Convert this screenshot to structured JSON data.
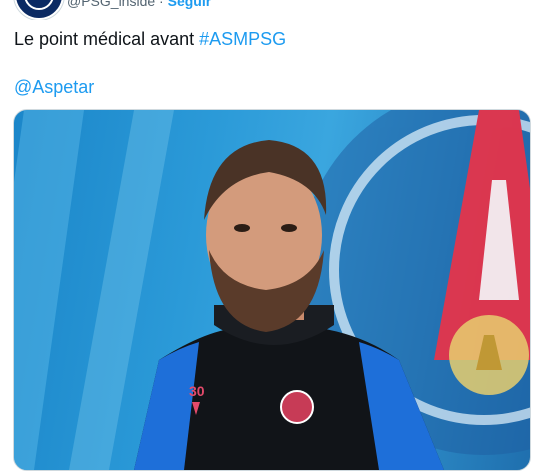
{
  "author": {
    "handle": "@PSG_inside",
    "separator": "·",
    "follow_label": "Seguir"
  },
  "tweet": {
    "text": "Le point médical avant ",
    "hashtag": "#ASMPSG",
    "mention": "@Aspetar"
  },
  "media": {
    "kit_number": "30",
    "description_colors": {
      "background": "#2b9ad8",
      "accent": "#e4334a",
      "kit": "#111418",
      "sleeve": "#1e6fd9"
    }
  },
  "icons": [
    "club-crest-icon"
  ]
}
